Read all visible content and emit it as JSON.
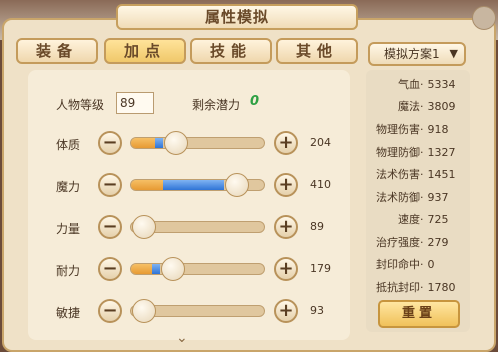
{
  "title": "属性模拟",
  "tabs": [
    {
      "label": "装备",
      "active": false
    },
    {
      "label": "加点",
      "active": true
    },
    {
      "label": "技能",
      "active": false
    },
    {
      "label": "其他",
      "active": false
    }
  ],
  "level": {
    "label": "人物等级",
    "value": "89"
  },
  "potential": {
    "label": "剩余潜力",
    "value": "0"
  },
  "attributes": [
    {
      "name": "体质",
      "value": "204",
      "orange_pct": 0.18,
      "blue_pct": 0.06
    },
    {
      "name": "魔力",
      "value": "410",
      "orange_pct": 0.24,
      "blue_pct": 0.46
    },
    {
      "name": "力量",
      "value": "89",
      "orange_pct": 0.0,
      "blue_pct": 0.0
    },
    {
      "name": "耐力",
      "value": "179",
      "orange_pct": 0.16,
      "blue_pct": 0.06
    },
    {
      "name": "敏捷",
      "value": "93",
      "orange_pct": 0.0,
      "blue_pct": 0.0
    }
  ],
  "scheme": {
    "label": "模拟方案1"
  },
  "stats": [
    {
      "name": "气血",
      "value": "5334"
    },
    {
      "name": "魔法",
      "value": "3809"
    },
    {
      "name": "物理伤害",
      "value": "918"
    },
    {
      "name": "物理防御",
      "value": "1327"
    },
    {
      "name": "法术伤害",
      "value": "1451"
    },
    {
      "name": "法术防御",
      "value": "937"
    },
    {
      "name": "速度",
      "value": "725"
    },
    {
      "name": "治疗强度",
      "value": "279"
    },
    {
      "name": "封印命中",
      "value": "0"
    },
    {
      "name": "抵抗封印",
      "value": "1780"
    }
  ],
  "reset_label": "重置",
  "colors": {
    "accent": "#f0c15a",
    "potential": "#2ea043",
    "fill_orange": "#e79a33",
    "fill_blue": "#2f74d6"
  }
}
